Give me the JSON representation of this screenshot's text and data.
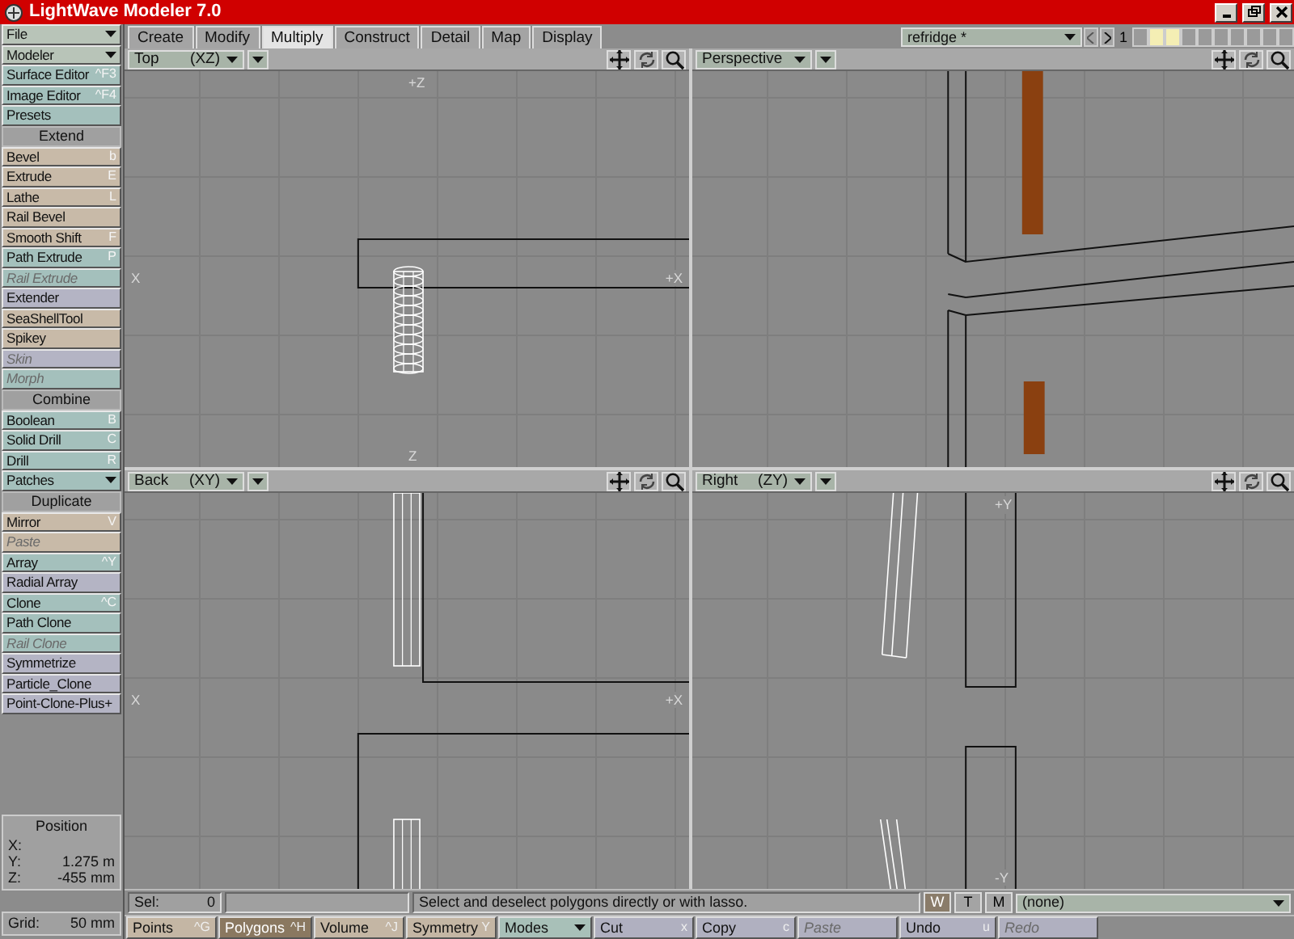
{
  "window": {
    "title": "LightWave Modeler 7.0"
  },
  "tabs": [
    {
      "label": "Create",
      "selected": false
    },
    {
      "label": "Modify",
      "selected": false
    },
    {
      "label": "Multiply",
      "selected": true
    },
    {
      "label": "Construct",
      "selected": false
    },
    {
      "label": "Detail",
      "selected": false
    },
    {
      "label": "Map",
      "selected": false
    },
    {
      "label": "Display",
      "selected": false
    }
  ],
  "object_selector": {
    "value": "refridge *"
  },
  "layer_number": "1",
  "layers": [
    {
      "selected": false
    },
    {
      "selected": true
    },
    {
      "selected": true
    },
    {
      "selected": false
    },
    {
      "selected": false
    },
    {
      "selected": false
    },
    {
      "selected": false
    },
    {
      "selected": false
    },
    {
      "selected": false
    },
    {
      "selected": false
    }
  ],
  "sidebar": {
    "items": [
      {
        "kind": "dropdown",
        "label": "File",
        "color": "#b8c4b8",
        "disabled": false
      },
      {
        "kind": "dropdown",
        "label": "Modeler",
        "color": "#b8c4b8",
        "disabled": false
      },
      {
        "kind": "button",
        "label": "Surface Editor",
        "shortcut": "^F3",
        "color": "#a4c0bc",
        "disabled": false
      },
      {
        "kind": "button",
        "label": "Image Editor",
        "shortcut": "^F4",
        "color": "#a4c0bc",
        "disabled": false
      },
      {
        "kind": "button",
        "label": "Presets",
        "color": "#a4c0bc",
        "disabled": false
      },
      {
        "kind": "header",
        "label": "Extend"
      },
      {
        "kind": "button",
        "label": "Bevel",
        "shortcut": "b",
        "color": "#c8baa8",
        "disabled": false
      },
      {
        "kind": "button",
        "label": "Extrude",
        "shortcut": "E",
        "color": "#c8baa8",
        "disabled": false
      },
      {
        "kind": "button",
        "label": "Lathe",
        "shortcut": "L",
        "color": "#c8baa8",
        "disabled": false
      },
      {
        "kind": "button",
        "label": "Rail Bevel",
        "color": "#c8baa8",
        "disabled": false
      },
      {
        "kind": "button",
        "label": "Smooth Shift",
        "shortcut": "F",
        "color": "#c8baa8",
        "disabled": false
      },
      {
        "kind": "button",
        "label": "Path Extrude",
        "shortcut": "P",
        "color": "#a4c0bc",
        "disabled": false
      },
      {
        "kind": "button",
        "label": "Rail Extrude",
        "color": "#a4c0bc",
        "disabled": true
      },
      {
        "kind": "button",
        "label": "Extender",
        "color": "#b4b4c4",
        "disabled": false
      },
      {
        "kind": "button",
        "label": "SeaShellTool",
        "color": "#c8baa8",
        "disabled": false
      },
      {
        "kind": "button",
        "label": "Spikey",
        "color": "#c8baa8",
        "disabled": false
      },
      {
        "kind": "button",
        "label": "Skin",
        "color": "#b4b4c4",
        "disabled": true
      },
      {
        "kind": "button",
        "label": "Morph",
        "color": "#a4c0bc",
        "disabled": true
      },
      {
        "kind": "header",
        "label": "Combine"
      },
      {
        "kind": "button",
        "label": "Boolean",
        "shortcut": "B",
        "color": "#a4c0bc",
        "disabled": false
      },
      {
        "kind": "button",
        "label": "Solid Drill",
        "shortcut": "C",
        "color": "#a4c0bc",
        "disabled": false
      },
      {
        "kind": "button",
        "label": "Drill",
        "shortcut": "R",
        "color": "#a4c0bc",
        "disabled": false
      },
      {
        "kind": "dropdown",
        "label": "Patches",
        "color": "#a4c0bc",
        "disabled": false
      },
      {
        "kind": "header",
        "label": "Duplicate"
      },
      {
        "kind": "button",
        "label": "Mirror",
        "shortcut": "V",
        "color": "#c8baa8",
        "disabled": false
      },
      {
        "kind": "button",
        "label": "Paste",
        "color": "#c8baa8",
        "disabled": true
      },
      {
        "kind": "button",
        "label": "Array",
        "shortcut": "^Y",
        "color": "#a4c0bc",
        "disabled": false
      },
      {
        "kind": "button",
        "label": "Radial Array",
        "color": "#b4b4c4",
        "disabled": false
      },
      {
        "kind": "button",
        "label": "Clone",
        "shortcut": "^C",
        "color": "#a4c0bc",
        "disabled": false
      },
      {
        "kind": "button",
        "label": "Path Clone",
        "color": "#a4c0bc",
        "disabled": false
      },
      {
        "kind": "button",
        "label": "Rail Clone",
        "color": "#a4c0bc",
        "disabled": true
      },
      {
        "kind": "button",
        "label": "Symmetrize",
        "color": "#b4b4c4",
        "disabled": false
      },
      {
        "kind": "button",
        "label": "Particle_Clone",
        "color": "#b4b4c4",
        "disabled": false
      },
      {
        "kind": "button",
        "label": "Point-Clone-Plus+",
        "color": "#b4b4c4",
        "disabled": false
      }
    ]
  },
  "position": {
    "title": "Position",
    "rows": [
      {
        "axis": "X:",
        "value": ""
      },
      {
        "axis": "Y:",
        "value": "1.275 m"
      },
      {
        "axis": "Z:",
        "value": "-455 mm"
      }
    ]
  },
  "grid": {
    "label": "Grid:",
    "value": "50 mm"
  },
  "viewports": [
    {
      "kind": "top",
      "name": "Top",
      "axes": "(XZ)",
      "labels": {
        "top": "+Z",
        "left": "X",
        "right": "+X",
        "bottom": "Z"
      }
    },
    {
      "kind": "perspective",
      "name": "Perspective"
    },
    {
      "kind": "back",
      "name": "Back",
      "axes": "(XY)",
      "labels": {
        "left": "X",
        "right": "+X"
      }
    },
    {
      "kind": "right",
      "name": "Right",
      "axes": "(ZY)",
      "labels": {
        "top": "+Y",
        "bottom": "-Y"
      }
    }
  ],
  "status_bar": {
    "sel_label": "Sel:",
    "sel_value": "0",
    "message": "Select and deselect polygons directly or with lasso.",
    "wtm": [
      {
        "label": "W",
        "selected": true
      },
      {
        "label": "T",
        "selected": false
      },
      {
        "label": "M",
        "selected": false
      }
    ],
    "surface": "(none)",
    "buttons": [
      {
        "kind": "mode",
        "label": "Points",
        "shortcut": "^G",
        "selected": false,
        "disabled": false
      },
      {
        "kind": "mode",
        "label": "Polygons",
        "shortcut": "^H",
        "selected": true,
        "disabled": false
      },
      {
        "kind": "mode",
        "label": "Volume",
        "shortcut": "^J",
        "selected": false,
        "disabled": false
      },
      {
        "kind": "mode",
        "label": "Symmetry",
        "shortcut": "Y",
        "selected": false,
        "disabled": false
      },
      {
        "kind": "dropdown",
        "label": "Modes",
        "disabled": false
      },
      {
        "kind": "action",
        "label": "Cut",
        "shortcut": "x",
        "disabled": false
      },
      {
        "kind": "action",
        "label": "Copy",
        "shortcut": "c",
        "disabled": false
      },
      {
        "kind": "action",
        "label": "Paste",
        "disabled": true
      },
      {
        "kind": "action",
        "label": "Undo",
        "shortcut": "u",
        "disabled": false
      },
      {
        "kind": "action",
        "label": "Redo",
        "disabled": true
      }
    ]
  }
}
